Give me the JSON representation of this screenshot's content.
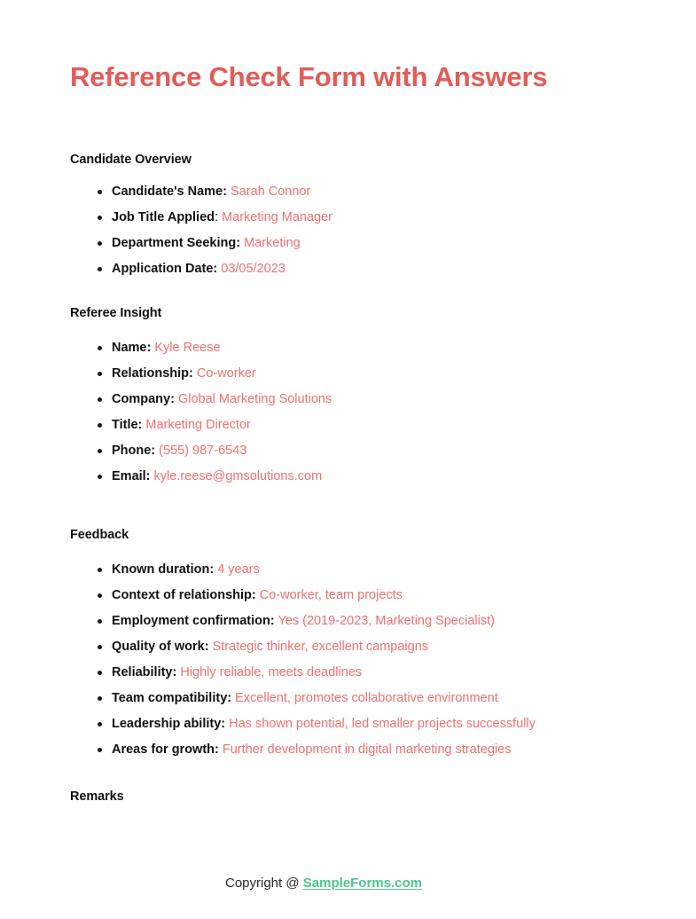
{
  "document": {
    "title": "Reference Check Form with Answers",
    "title_color": "#e35b58",
    "answer_color": "#f0706e",
    "link_color": "#4cc68f"
  },
  "sections": {
    "candidate_overview": {
      "heading": "Candidate Overview",
      "items": [
        {
          "label": "Candidate's Name:",
          "value": "Sarah Connor"
        },
        {
          "label": "Job Title Applied",
          "separator": ":",
          "value": "Marketing Manager"
        },
        {
          "label": "Department Seeking:",
          "value": "Marketing"
        },
        {
          "label": "Application Date:",
          "value": "03/05/2023"
        }
      ]
    },
    "referee_insight": {
      "heading": "Referee Insight",
      "items": [
        {
          "label": "Name:",
          "value": "Kyle Reese"
        },
        {
          "label": "Relationship:",
          "value": "Co-worker"
        },
        {
          "label": "Company:",
          "value": "Global Marketing Solutions"
        },
        {
          "label": "Title:",
          "value": "Marketing Director"
        },
        {
          "label": "Phone:",
          "value": "(555) 987-6543"
        },
        {
          "label": "Email:",
          "value": "kyle.reese@gmsolutions.com"
        }
      ]
    },
    "feedback": {
      "heading": "Feedback",
      "items": [
        {
          "label": "Known duration:",
          "value": "4 years"
        },
        {
          "label": "Context of relationship:",
          "value": "Co-worker, team projects"
        },
        {
          "label": "Employment confirmation:",
          "value": "Yes (2019-2023, Marketing Specialist)"
        },
        {
          "label": "Quality of work:",
          "value": "Strategic thinker, excellent campaigns"
        },
        {
          "label": "Reliability:",
          "value": "Highly reliable, meets deadlines"
        },
        {
          "label": "Team compatibility:",
          "value": "Excellent, promotes collaborative environment"
        },
        {
          "label": "Leadership ability:",
          "value": "Has shown potential, led smaller projects successfully"
        },
        {
          "label": "Areas for growth:",
          "value": "Further development in digital marketing strategies"
        }
      ]
    },
    "remarks": {
      "heading": "Remarks"
    }
  },
  "footer": {
    "copyright_text": "Copyright @",
    "link_label": "SampleForms.com"
  }
}
